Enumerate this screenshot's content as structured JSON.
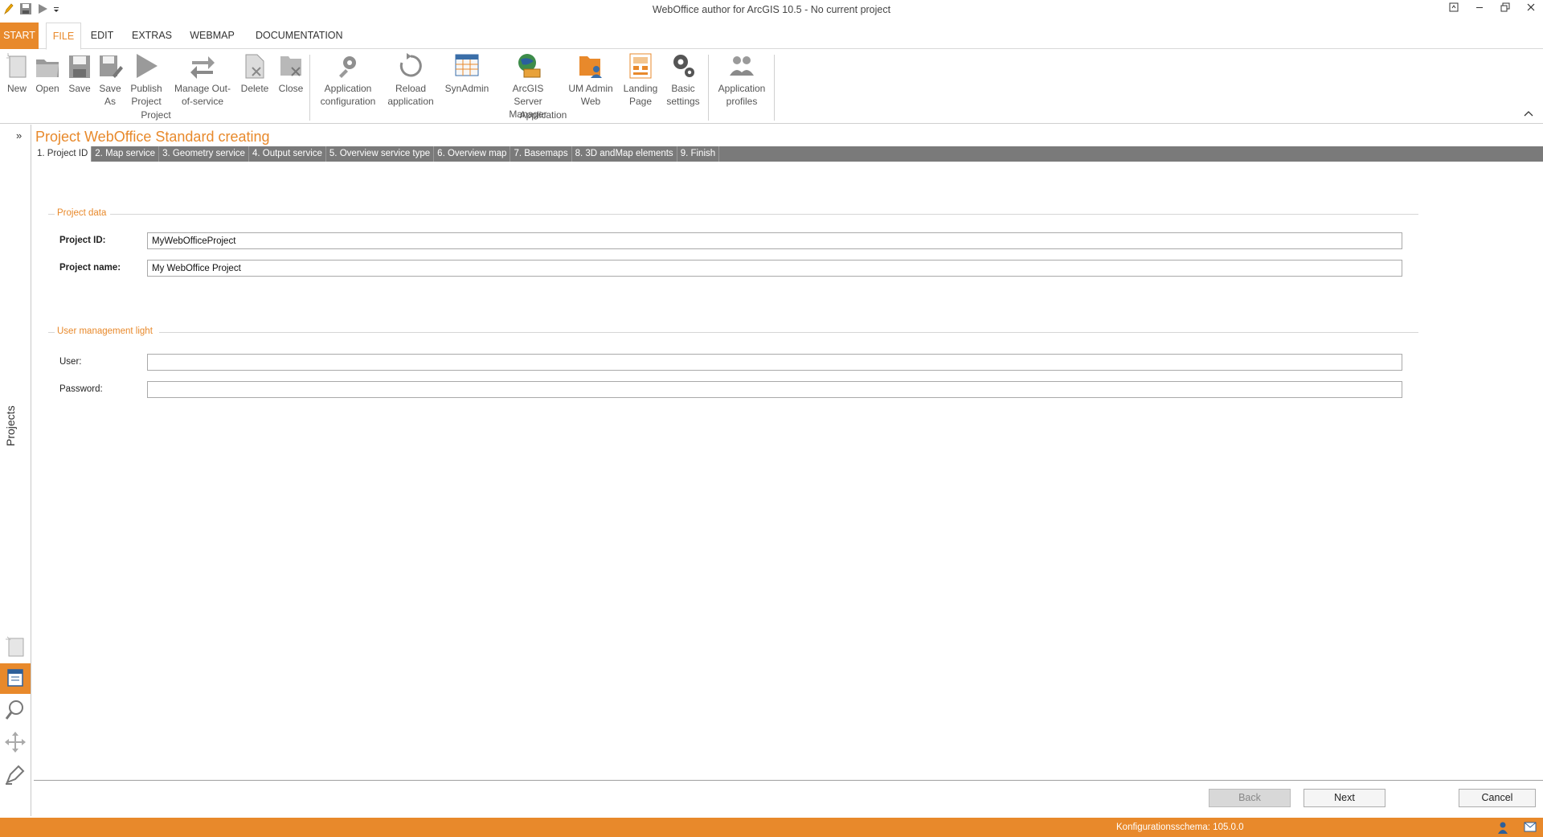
{
  "window": {
    "title": "WebOffice author for ArcGIS 10.5 - No current project"
  },
  "menu": {
    "start": "START",
    "tabs": [
      {
        "label": "FILE"
      },
      {
        "label": "EDIT"
      },
      {
        "label": "EXTRAS"
      },
      {
        "label": "WEBMAP"
      },
      {
        "label": "DOCUMENTATION"
      }
    ]
  },
  "ribbon": {
    "project": {
      "group_label": "Project",
      "buttons": [
        {
          "label": "New",
          "icon": "new-document-icon"
        },
        {
          "label": "Open",
          "icon": "folder-open-icon"
        },
        {
          "label": "Save",
          "icon": "save-icon"
        },
        {
          "label": "Save As",
          "icon": "save-as-icon"
        },
        {
          "label": "Publish Project",
          "icon": "play-icon"
        },
        {
          "label": "Manage Out-of-service",
          "icon": "swap-arrows-icon"
        },
        {
          "label": "Delete",
          "icon": "delete-document-icon"
        },
        {
          "label": "Close",
          "icon": "close-document-icon"
        }
      ]
    },
    "application": {
      "group_label": "Application",
      "buttons": [
        {
          "label": "Application configuration",
          "icon": "gears-icon"
        },
        {
          "label": "Reload application",
          "icon": "reload-icon"
        },
        {
          "label": "SynAdmin",
          "icon": "table-icon"
        },
        {
          "label": "ArcGIS Server Manager",
          "icon": "globe-server-icon"
        },
        {
          "label": "UM Admin Web",
          "icon": "user-folder-icon"
        },
        {
          "label": "Landing Page",
          "icon": "landing-page-icon"
        },
        {
          "label": "Basic settings",
          "icon": "settings-gears-icon"
        }
      ]
    },
    "profiles": {
      "buttons": [
        {
          "label": "Application profiles",
          "icon": "users-icon"
        }
      ]
    }
  },
  "sidebar": {
    "projects_label": "Projects"
  },
  "main": {
    "title": "Project WebOffice Standard creating",
    "steps": [
      "1. Project ID",
      "2. Map service",
      "3. Geometry service",
      "4. Output service",
      "5. Overview service type",
      "6. Overview map",
      "7. Basemaps",
      "8. 3D andMap elements",
      "9. Finish"
    ],
    "project_data": {
      "title": "Project data",
      "project_id_label": "Project ID:",
      "project_id_value": "MyWebOfficeProject",
      "project_name_label": "Project name:",
      "project_name_value": "My WebOffice Project"
    },
    "user_management": {
      "title": "User management light",
      "user_label": "User:",
      "user_value": "",
      "password_label": "Password:",
      "password_value": ""
    },
    "buttons": {
      "back": "Back",
      "next": "Next",
      "cancel": "Cancel"
    }
  },
  "statusbar": {
    "schema": "Konfigurationsschema:  105.0.0"
  },
  "colors": {
    "accent": "#e8892b",
    "steps_bar": "#7a7a7a"
  }
}
